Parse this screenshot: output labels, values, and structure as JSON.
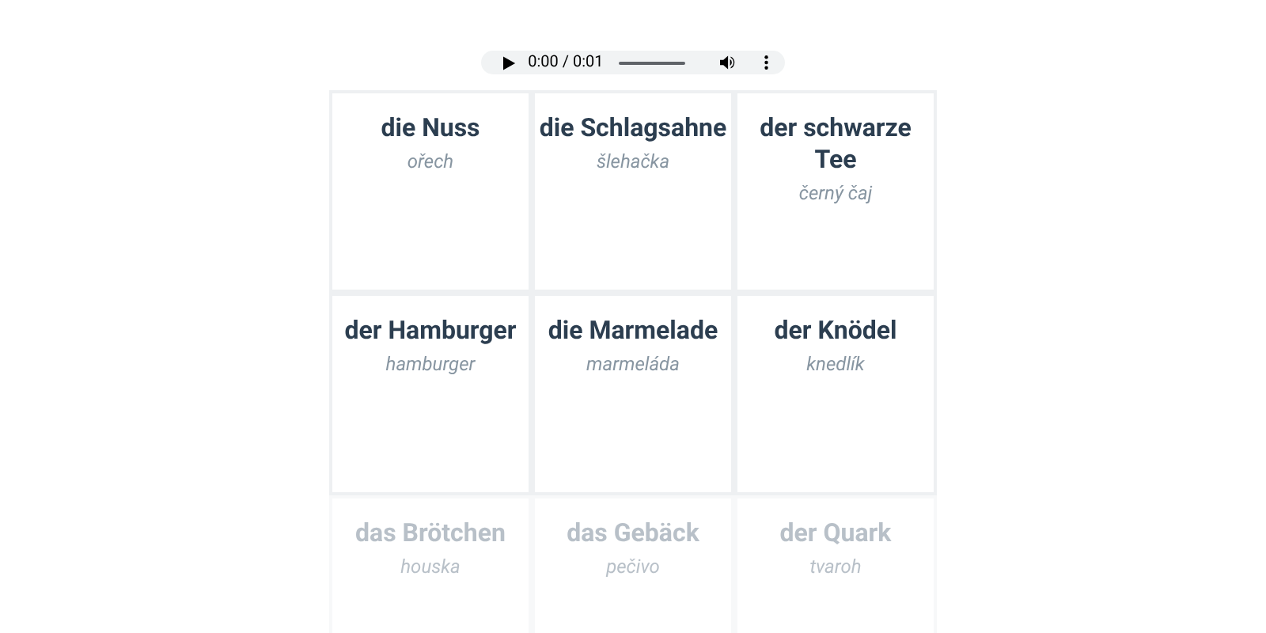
{
  "audio_player": {
    "time": "0:00 / 0:01",
    "level": 0
  },
  "cards": [
    {
      "word": "die Nuss",
      "translation": "ořech",
      "faded": false
    },
    {
      "word": "die Schlagsahne",
      "translation": "šlehačka",
      "faded": false
    },
    {
      "word": "der schwarze Tee",
      "translation": "černý čaj",
      "faded": false
    },
    {
      "word": "der Hamburger",
      "translation": "hamburger",
      "faded": false
    },
    {
      "word": "die Marmelade",
      "translation": "marmeláda",
      "faded": false
    },
    {
      "word": "der Knödel",
      "translation": "knedlík",
      "faded": false
    },
    {
      "word": "das Brötchen",
      "translation": "houska",
      "faded": true
    },
    {
      "word": "das Gebäck",
      "translation": "pečivo",
      "faded": true
    },
    {
      "word": "der Quark",
      "translation": "tvaroh",
      "faded": true
    }
  ]
}
